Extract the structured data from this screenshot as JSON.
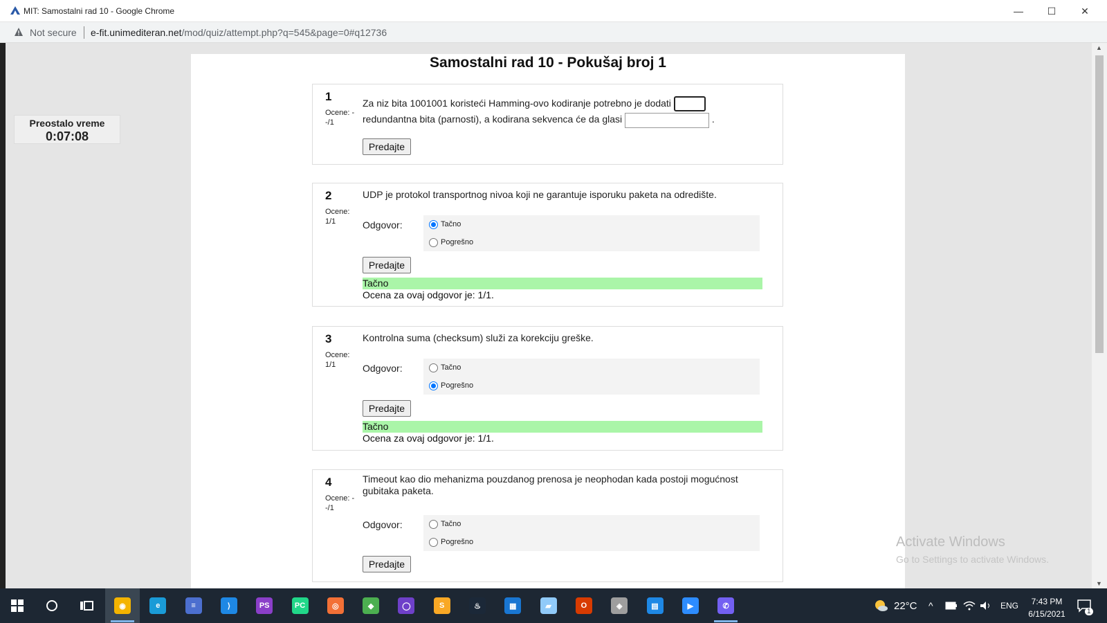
{
  "window": {
    "title": "MIT: Samostalni rad 10 - Google Chrome",
    "minimize": "—",
    "maximize": "☐",
    "close": "✕"
  },
  "address": {
    "not_secure": "Not secure",
    "host": "e-fit.unimediteran.net",
    "path": "/mod/quiz/attempt.php?q=545&page=0#q12736"
  },
  "timer": {
    "label": "Preostalo vreme",
    "value": "0:07:08"
  },
  "page": {
    "title": "Samostalni rad 10 - Pokušaj broj 1"
  },
  "questions": [
    {
      "number": "1",
      "grade_line1": "Ocene: -",
      "grade_line2": "-/1",
      "text_a": "Za niz bita 1001001 koristeći Hamming-ovo kodiranje potrebno je dodati",
      "text_b": "redundantna bita (parnosti), a kodirana sekvenca će da glasi",
      "text_c": ".",
      "submit": "Predajte"
    },
    {
      "number": "2",
      "grade_line1": "Ocene:",
      "grade_line2": "1/1",
      "text": "UDP je protokol transportnog nivoa koji ne garantuje isporuku paketa na odredište.",
      "answer_label": "Odgovor:",
      "options": [
        "Tačno",
        "Pogrešno"
      ],
      "selected": 0,
      "submit": "Predajte",
      "feedback": "Tačno",
      "grade_text": "Ocena za ovaj odgovor je: 1/1."
    },
    {
      "number": "3",
      "grade_line1": "Ocene:",
      "grade_line2": "1/1",
      "text": "Kontrolna suma (checksum) služi za korekciju greške.",
      "answer_label": "Odgovor:",
      "options": [
        "Tačno",
        "Pogrešno"
      ],
      "selected": 1,
      "submit": "Predajte",
      "feedback": "Tačno",
      "grade_text": "Ocena za ovaj odgovor je: 1/1."
    },
    {
      "number": "4",
      "grade_line1": "Ocene: -",
      "grade_line2": "-/1",
      "text": "Timeout kao dio mehanizma pouzdanog prenosa je neophodan kada postoji mogućnost gubitaka paketa.",
      "answer_label": "Odgovor:",
      "options": [
        "Tačno",
        "Pogrešno"
      ],
      "selected": null,
      "submit": "Predajte"
    }
  ],
  "watermark": {
    "line1": "Activate Windows",
    "line2": "Go to Settings to activate Windows."
  },
  "taskbar": {
    "apps": [
      {
        "name": "chrome",
        "color": "#f4b400"
      },
      {
        "name": "edge",
        "color": "#1a9bd7"
      },
      {
        "name": "generic",
        "color": "#4c6fcf"
      },
      {
        "name": "vscode",
        "color": "#1e88e5"
      },
      {
        "name": "phpstorm",
        "color": "#8b3fc9"
      },
      {
        "name": "pycharm",
        "color": "#21d789"
      },
      {
        "name": "postman",
        "color": "#f37036"
      },
      {
        "name": "generic2",
        "color": "#4caf50"
      },
      {
        "name": "github",
        "color": "#6e40c9"
      },
      {
        "name": "sublime",
        "color": "#f9a825"
      },
      {
        "name": "steam",
        "color": "#1b2838"
      },
      {
        "name": "calculator",
        "color": "#1976d2"
      },
      {
        "name": "notes",
        "color": "#90caf9"
      },
      {
        "name": "office",
        "color": "#d83b01"
      },
      {
        "name": "game",
        "color": "#9e9e9e"
      },
      {
        "name": "calendar",
        "color": "#1e88e5"
      },
      {
        "name": "zoom",
        "color": "#2d8cff"
      },
      {
        "name": "viber",
        "color": "#7360f2"
      }
    ],
    "weather": "22°C",
    "lang": "ENG",
    "time": "7:43 PM",
    "date": "6/15/2021",
    "notifications": "1"
  }
}
